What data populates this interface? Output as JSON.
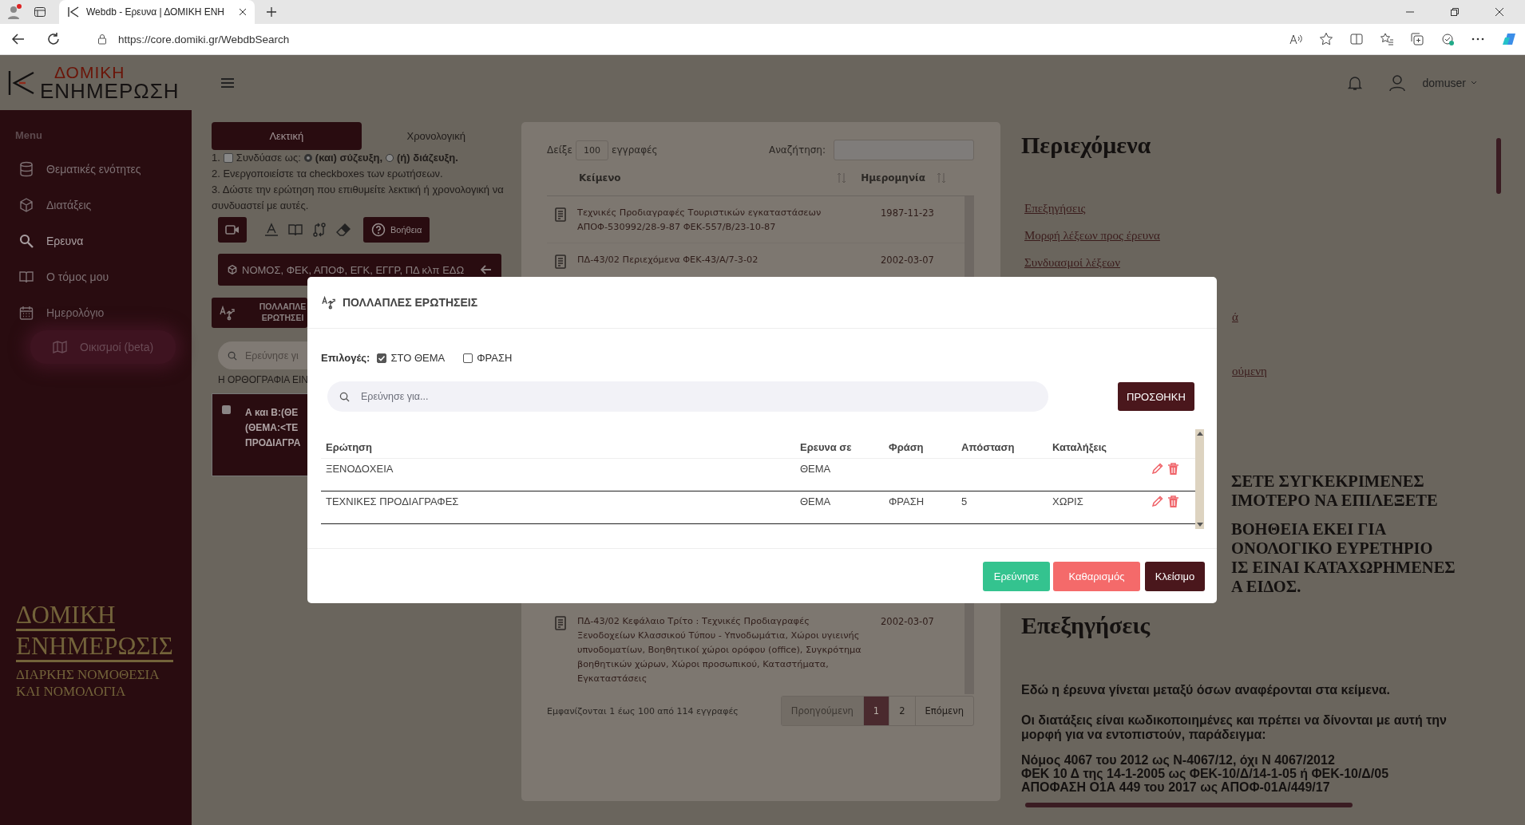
{
  "browser": {
    "tab_title": "Webdb - Ερευνα | ΔΟΜΙΚΗ ΕΝΗ",
    "url": "https://core.domiki.gr/WebdbSearch"
  },
  "header": {
    "logo_top": "ΔΟΜΙΚΗ",
    "logo_bottom": "ΕΝΗΜΕΡΩΣΗ",
    "user": "domuser"
  },
  "sidebar": {
    "heading": "Menu",
    "items": [
      {
        "label": "Θεματικές ενότητες",
        "selected": false,
        "glow": false
      },
      {
        "label": "Διατάξεις",
        "selected": false,
        "glow": false
      },
      {
        "label": "Ερευνα",
        "selected": true,
        "glow": false
      },
      {
        "label": "Ο τόμος μου",
        "selected": false,
        "glow": false
      },
      {
        "label": "Ημερολόγιο",
        "selected": false,
        "glow": false
      },
      {
        "label": "Οικισμοί (beta)",
        "selected": false,
        "glow": true
      }
    ],
    "brand": {
      "title": [
        "ΔΟΜΙΚΗ",
        "ΕΝΗΜΕΡΩΣΙΣ"
      ],
      "subtitle": [
        "ΔΙΑΡΚΗΣ ΝΟΜΟΘΕΣΙΑ",
        "ΚΑΙ ΝΟΜΟΛΟΓΙΑ"
      ]
    }
  },
  "search_panel": {
    "tabs": [
      {
        "label": "Λεκτική",
        "selected": true
      },
      {
        "label": "Χρονολογική",
        "selected": false
      }
    ],
    "combine": {
      "prefix": "1.",
      "checked": false,
      "label": "Συνδύασε ως:",
      "options": [
        {
          "label": "(και) σύζευξη,",
          "selected": true
        },
        {
          "label": "(ή) διάζευξη.",
          "selected": false
        }
      ]
    },
    "steps": [
      "2. Ενεργοποιείστε τα checkboxes των ερωτήσεων.",
      "3. Δώστε την ερώτηση που επιθυμείτε λεκτική ή χρονολογική να συνδυαστεί με αυτές."
    ],
    "help_button": "Βοήθεια",
    "codes_button": "ΝΟΜΟΣ, ΦΕΚ, ΑΠΟΦ, ΕΓΚ, ΕΓΓΡ, ΠΔ κλπ ΕΔΩ",
    "multi_button": "ΠΟΛΛΑΠΛΕ ΕΡΩΤΗΣΕΙ",
    "search_placeholder": "Ερεύνησε γι",
    "spelling_note": "Η ΟΡΘΟΓΡΑΦΙΑ ΕΙΝ",
    "queries": [
      {
        "checked": false,
        "lines": [
          "Α και Β:(ΘΕ",
          "(ΘΕΜΑ:<ΤΕ",
          "ΠΡΟΔΙΑΓΡΑ"
        ]
      }
    ]
  },
  "records": {
    "show_prefix": "Δείξε",
    "page_size": "100",
    "show_suffix": "εγγραφές",
    "search_label": "Αναζήτηση:",
    "columns": [
      "Κείμενο",
      "Ημερομηνία"
    ],
    "rows": [
      {
        "text": "Τεχνικές Προδιαγραφές Τουριστικών εγκαταστάσεων ΑΠΟΦ-530992/28-9-87 ΦΕΚ-557/Β/23-10-87",
        "date": "1987-11-23"
      },
      {
        "text": "ΠΔ-43/02 Περιεχόμενα ΦΕΚ-43/Α/7-3-02",
        "date": "2002-03-07"
      },
      {
        "text": "ΠΔ-43/02 Κεφάλαιο Τρίτο : Τεχνικές Προδιαγραφές Ξενοδοχείων Κλασσικού Τύπου - Υπνοδωμάτια, Χώροι υγιεινής υπνοδοματίων, Βοηθητικοί χώροι ορόφου (office), Συγκρότημα βοηθητικών χώρων, Χώροι προσωπικού, Καταστήματα, Εγκαταστάσεις",
        "date": "2002-03-07"
      }
    ],
    "info": "Εμφανίζονται 1 έως 100 από 114 εγγραφές",
    "pages": [
      {
        "label": "Προηγούμενη",
        "selected": false,
        "disabled": true
      },
      {
        "label": "1",
        "selected": true,
        "disabled": false
      },
      {
        "label": "2",
        "selected": false,
        "disabled": false
      },
      {
        "label": "Επόμενη",
        "selected": false,
        "disabled": false
      }
    ]
  },
  "contents": {
    "title": "Περιεχόμενα",
    "links": [
      "Επεξηγήσεις",
      "Μορφή λέξεων προς έρευνα",
      "Συνδυασμοί λέξεων"
    ],
    "partial_links": [
      "ά",
      "ούμενη"
    ],
    "notices": [
      [
        "ΣΕΤΕ ΣΥΓΚΕΚΡΙΜΕΝΕΣ",
        "ΙΜΟΤΕΡΟ ΝΑ ΕΠΙΛΕΞΕΤΕ"
      ],
      [
        "ΒΟΗΘΕΙΑ ΕΚΕΙ ΓΙΑ",
        "ΟΝΟΛΟΓΙΚΟ ΕΥΡΕΤΗΡΙΟ",
        "ΙΣ ΕΙΝΑΙ ΚΑΤΑΧΩΡΗΜΕΝΕΣ",
        "Α ΕΙΔΟΣ."
      ]
    ],
    "explanations_title": "Επεξηγήσεις",
    "paragraphs": [
      "Εδώ η έρευνα γίνεται μεταξύ όσων αναφέρονται στα κείμενα.",
      "Οι διατάξεις είναι κωδικοποιημένες και πρέπει να δίνονται με αυτή την μορφή για να εντοπιστούν, παράδειγμα:"
    ],
    "examples": [
      "Νόμος 4067 του 2012  ως Ν-4067/12, όχι Ν 4067/2012",
      "ΦΕΚ 10 Δ της 14-1-2005 ως ΦΕΚ-10/Δ/14-1-05 ή ΦΕΚ-10/Δ/05",
      "ΑΠΟΦΑΣΗ Ο1Α 449 του 2017 ως ΑΠΟΦ-01Α/449/17"
    ]
  },
  "modal": {
    "title": "ΠΟΛΛΑΠΛΕΣ ΕΡΩΤΗΣΕΙΣ",
    "options_label": "Επιλογές:",
    "options": [
      {
        "label": "ΣΤΟ ΘΕΜΑ",
        "checked": true
      },
      {
        "label": "ΦΡΑΣΗ",
        "checked": false
      }
    ],
    "search_placeholder": "Ερεύνησε για...",
    "add_button": "ΠΡΟΣΘΗΚΗ",
    "columns": [
      "Ερώτηση",
      "Ερευνα σε",
      "Φράση",
      "Απόσταση",
      "Καταλήξεις"
    ],
    "rows": [
      {
        "query": "ΞΕΝΟΔΟΧΕΙΑ",
        "search_in": "ΘΕΜΑ"
      },
      {
        "query": "ΤΕΧΝΙΚΕΣ ΠΡΟΔΙΑΓΡΑΦΕΣ",
        "search_in": "ΘΕΜΑ",
        "phrase": "ΦΡΑΣΗ",
        "distance": "5",
        "endings": "ΧΩΡΙΣ"
      }
    ],
    "buttons": [
      {
        "label": "Ερεύνησε",
        "kind": "search"
      },
      {
        "label": "Καθαρισμός",
        "kind": "clear"
      },
      {
        "label": "Κλείσιμο",
        "kind": "close"
      }
    ]
  }
}
